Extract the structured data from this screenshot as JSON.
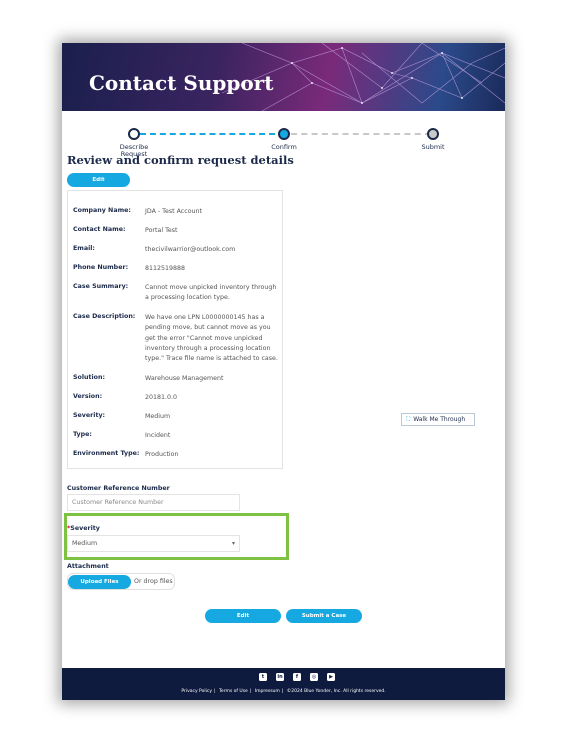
{
  "header": {
    "title": "Contact Support"
  },
  "stepper": {
    "steps": [
      {
        "label_line1": "Describe",
        "label_line2": "Request"
      },
      {
        "label": "Confirm"
      },
      {
        "label": "Submit"
      }
    ]
  },
  "review": {
    "title": "Review and confirm request details",
    "edit_label": "Edit"
  },
  "details": [
    {
      "label": "Company Name:",
      "value": "JDA - Test Account"
    },
    {
      "label": "Contact Name:",
      "value": "Portal Test"
    },
    {
      "label": "Email:",
      "value": "thecivilwarrior@outlook.com"
    },
    {
      "label": "Phone Number:",
      "value": "8112519888"
    },
    {
      "label": "Case Summary:",
      "value": "Cannot move unpicked inventory through a processing location type."
    },
    {
      "label": "Case Description:",
      "value": "We have one LPN L0000000145 has a pending move, but cannot move as you get the error \"Cannot move unpicked inventory through a processing location type.\" Trace file name is attached to case."
    },
    {
      "label": "Solution:",
      "value": "Warehouse Management"
    },
    {
      "label": "Version:",
      "value": "20181.0.0"
    },
    {
      "label": "Severity:",
      "value": "Medium"
    },
    {
      "label": "Type:",
      "value": "Incident"
    },
    {
      "label": "Environment Type:",
      "value": "Production"
    }
  ],
  "walkme": {
    "label": "Walk Me Through",
    "icon": "expand-icon"
  },
  "form": {
    "customer_ref_label": "Customer Reference Number",
    "customer_ref_placeholder": "Customer Reference Number",
    "severity_required": "*",
    "severity_label": "Severity",
    "severity_value": "Medium",
    "attachment_label": "Attachment",
    "upload_label": "Upload Files",
    "drop_label": "Or drop files"
  },
  "actions": {
    "edit_label": "Edit",
    "submit_label": "Submit a Case"
  },
  "footer": {
    "social": [
      "twitter-icon",
      "linkedin-icon",
      "facebook-icon",
      "instagram-icon",
      "youtube-icon"
    ],
    "links": [
      "Privacy Policy",
      "Terms of Use",
      "Impressum"
    ],
    "copyright": "©2024 Blue Yonder, Inc. All rights reserved."
  },
  "colors": {
    "accent": "#16a8e0",
    "navy": "#0e1b3f",
    "highlight": "#7dc243"
  }
}
